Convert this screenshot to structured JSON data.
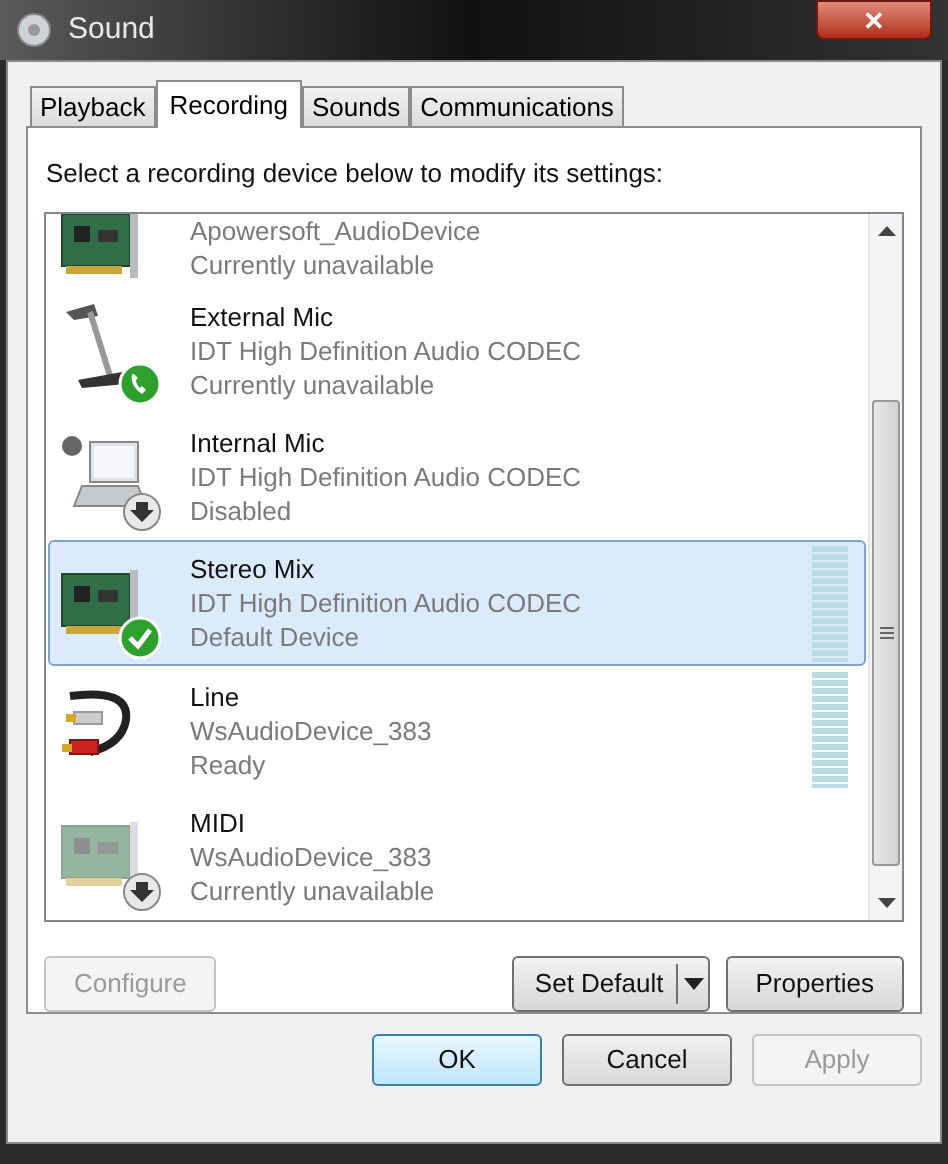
{
  "window": {
    "title": "Sound",
    "close": "✕"
  },
  "tabs": [
    {
      "label": "Playback",
      "selected": false
    },
    {
      "label": "Recording",
      "selected": true
    },
    {
      "label": "Sounds",
      "selected": false
    },
    {
      "label": "Communications",
      "selected": false
    }
  ],
  "instruction": "Select a recording device below to modify its settings:",
  "devices": [
    {
      "kind": "card",
      "driver": "Apowersoft_AudioDevice",
      "status": "Currently unavailable",
      "selected": false,
      "meter": false
    },
    {
      "kind": "mic",
      "overlay": {
        "kind": "phone"
      },
      "name": "External Mic",
      "driver": "IDT High Definition Audio CODEC",
      "status": "Currently unavailable",
      "selected": false,
      "meter": false
    },
    {
      "kind": "laptop",
      "overlay": {
        "kind": "down"
      },
      "name": "Internal Mic",
      "driver": "IDT High Definition Audio CODEC",
      "status": "Disabled",
      "selected": false,
      "meter": false
    },
    {
      "kind": "card",
      "overlay": {
        "kind": "check"
      },
      "name": "Stereo Mix",
      "driver": "IDT High Definition Audio CODEC",
      "status": "Default Device",
      "selected": true,
      "meter": true
    },
    {
      "kind": "cable",
      "name": "Line",
      "driver": "WsAudioDevice_383",
      "status": "Ready",
      "selected": false,
      "meter": true
    },
    {
      "kind": "faded",
      "overlay": {
        "kind": "down"
      },
      "name": "MIDI",
      "driver": "WsAudioDevice_383",
      "status": "Currently unavailable",
      "selected": false,
      "meter": false
    }
  ],
  "panel_buttons": [
    {
      "label": "Configure",
      "disabled": true,
      "split": false
    },
    {
      "label": "Set Default",
      "disabled": false,
      "split": true
    },
    {
      "label": "Properties",
      "disabled": false,
      "split": false
    }
  ],
  "dialog_buttons": [
    {
      "label": "OK",
      "disabled": false,
      "default": true
    },
    {
      "label": "Cancel",
      "disabled": false,
      "default": false
    },
    {
      "label": "Apply",
      "disabled": true,
      "default": false
    }
  ]
}
